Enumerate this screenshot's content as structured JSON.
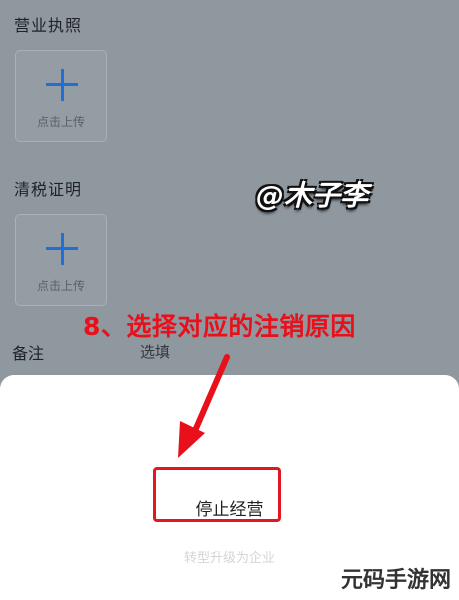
{
  "form": {
    "license_title": "营业执照",
    "license_upload_label": "点击上传",
    "tax_title": "清税证明",
    "tax_upload_label": "点击上传",
    "remark_label": "备注",
    "remark_placeholder": "选填"
  },
  "watermark": "@木子李",
  "annotation": "8、选择对应的注销原因",
  "sheet": {
    "option_stop": "停止经营",
    "option_other": "转型升级为企业"
  },
  "site_logo": "元码手游网",
  "colors": {
    "annotation_red": "#e8101b",
    "plus_blue": "#1f6fd6",
    "sheet_bg": "#ffffff",
    "overlay": "#8f979f"
  }
}
